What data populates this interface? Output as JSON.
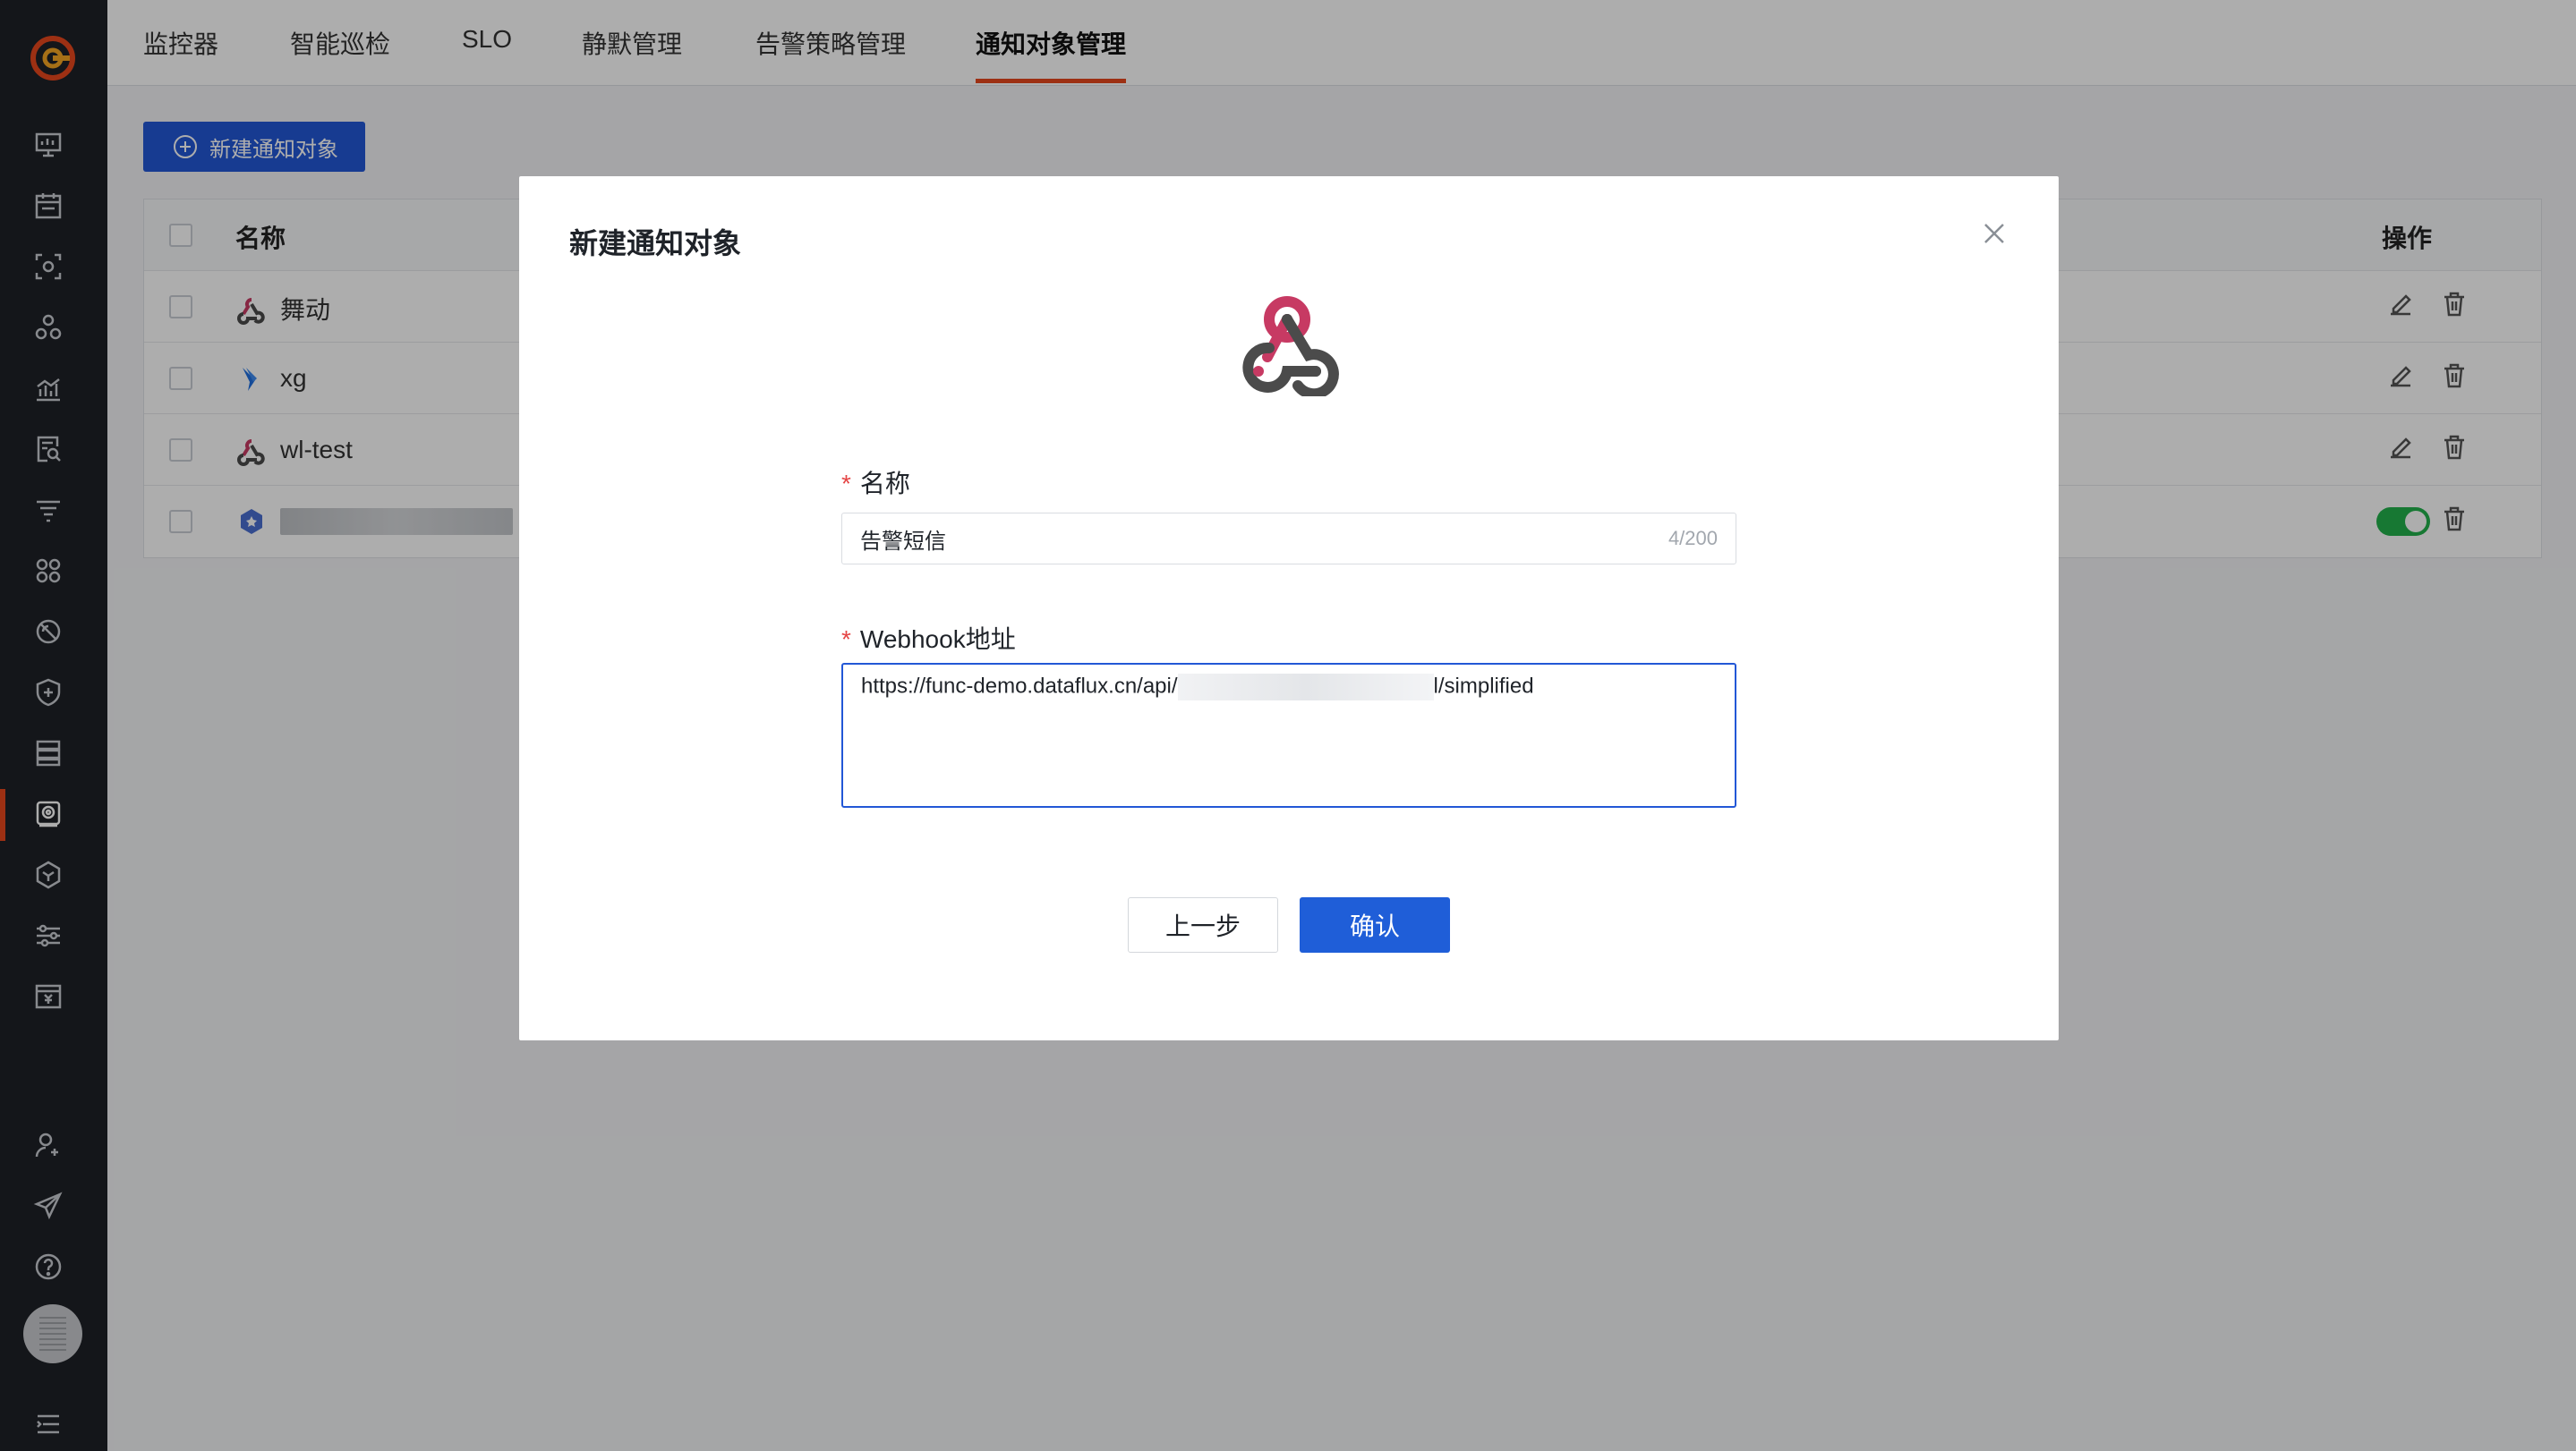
{
  "nav": {
    "tabs": [
      {
        "label": "监控器"
      },
      {
        "label": "智能巡检"
      },
      {
        "label": "SLO"
      },
      {
        "label": "静默管理"
      },
      {
        "label": "告警策略管理"
      },
      {
        "label": "通知对象管理"
      }
    ],
    "active_tab": "通知对象管理"
  },
  "sidebar": {
    "icons": [
      "dashboard-icon",
      "calendar-icon",
      "scan-icon",
      "cluster-icon",
      "chart-icon",
      "log-search-icon",
      "filter-icon",
      "apps-icon",
      "security-icon",
      "shield-icon",
      "server-icon",
      "monitor-icon",
      "cube-icon",
      "settings-icon",
      "billing-icon"
    ],
    "bottom_icons": [
      "add-user-icon",
      "send-icon",
      "help-icon",
      "menu-icon"
    ]
  },
  "main": {
    "new_button_label": "新建通知对象",
    "table": {
      "headers": {
        "name": "名称",
        "ops": "操作"
      },
      "rows": [
        {
          "name": "舞动",
          "icon": "webhook-icon"
        },
        {
          "name": "xg",
          "icon": "feishu-icon"
        },
        {
          "name": "wl-test",
          "icon": "webhook-icon"
        },
        {
          "name": "",
          "icon": "wecom-icon",
          "toggle_on": true
        }
      ]
    }
  },
  "modal": {
    "title": "新建通知对象",
    "icon": "webhook-icon",
    "name_label": "名称",
    "name_value": "告警短信",
    "name_count": "4/200",
    "webhook_label": "Webhook地址",
    "webhook_prefix": "https://func-demo.dataflux.cn/api/",
    "webhook_suffix": "l/simplified",
    "prev_label": "上一步",
    "confirm_label": "确认"
  },
  "colors": {
    "accent": "#e8471d",
    "primary": "#2257d6",
    "toggle_on": "#22b14c",
    "sidebar_bg": "#1e2127"
  }
}
